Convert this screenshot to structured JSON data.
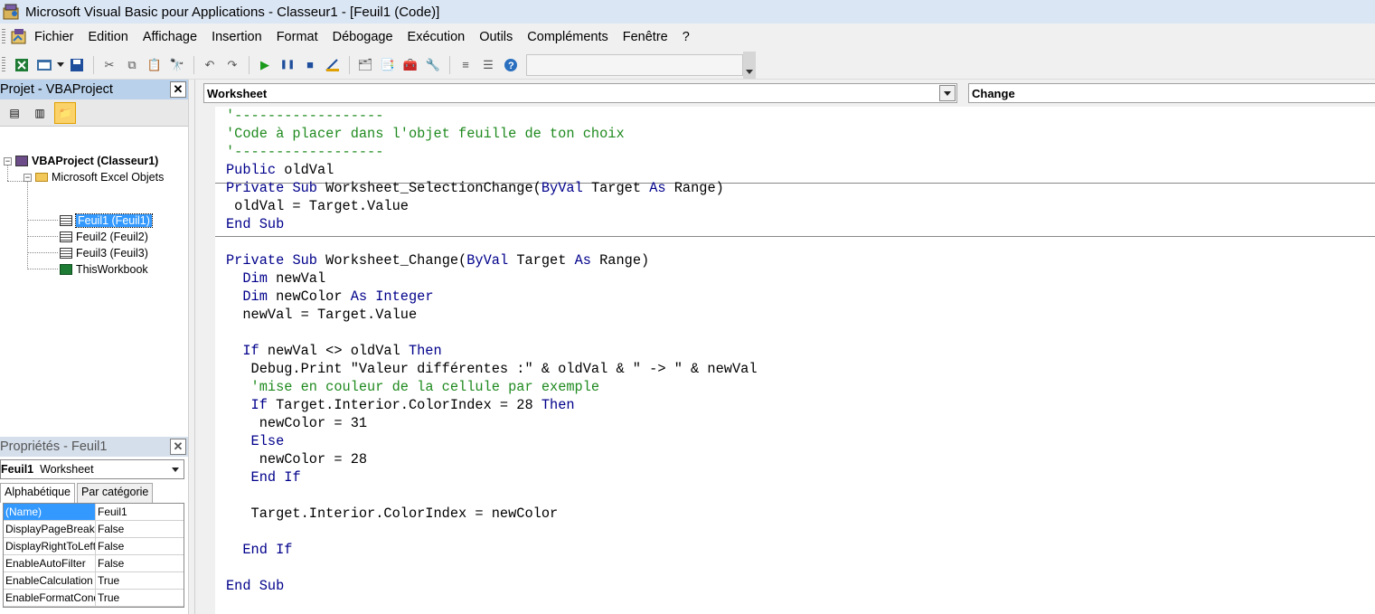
{
  "window": {
    "title": "Microsoft Visual Basic pour Applications - Classeur1 - [Feuil1 (Code)]"
  },
  "menu": [
    "Fichier",
    "Edition",
    "Affichage",
    "Insertion",
    "Format",
    "Débogage",
    "Exécution",
    "Outils",
    "Compléments",
    "Fenêtre",
    "?"
  ],
  "project": {
    "title": "Projet - VBAProject",
    "root": "VBAProject (Classeur1)",
    "folder": "Microsoft Excel Objets",
    "items": [
      "Feuil1 (Feuil1)",
      "Feuil2 (Feuil2)",
      "Feuil3 (Feuil3)",
      "ThisWorkbook"
    ],
    "selected_item": "Feuil1 (Feuil1)"
  },
  "properties": {
    "title": "Propriétés - Feuil1",
    "object_name": "Feuil1",
    "object_type": "Worksheet",
    "tabs": [
      "Alphabétique",
      "Par catégorie"
    ],
    "rows": [
      {
        "name": "(Name)",
        "value": "Feuil1"
      },
      {
        "name": "DisplayPageBreaks",
        "value": "False"
      },
      {
        "name": "DisplayRightToLeft",
        "value": "False"
      },
      {
        "name": "EnableAutoFilter",
        "value": "False"
      },
      {
        "name": "EnableCalculation",
        "value": "True"
      },
      {
        "name": "EnableFormatConditionsCalculation",
        "value": "True"
      }
    ]
  },
  "code": {
    "object_combo": "Worksheet",
    "procedure_combo": "Change",
    "lines": [
      "'------------------",
      "'Code à placer dans l'objet feuille de ton choix",
      "'------------------",
      "Public oldVal",
      "Private Sub Worksheet_SelectionChange(ByVal Target As Range)",
      " oldVal = Target.Value",
      "End Sub",
      "",
      "Private Sub Worksheet_Change(ByVal Target As Range)",
      "  Dim newVal",
      "  Dim newColor As Integer",
      "  newVal = Target.Value",
      "",
      "  If newVal <> oldVal Then",
      "   Debug.Print \"Valeur différentes :\" & oldVal & \" -> \" & newVal",
      "   'mise en couleur de la cellule par exemple",
      "   If Target.Interior.ColorIndex = 28 Then",
      "    newColor = 31",
      "   Else",
      "    newColor = 28",
      "   End If",
      "",
      "   Target.Interior.ColorIndex = newColor",
      "",
      "  End If",
      "",
      "End Sub"
    ]
  },
  "colors": {
    "keyword": "#00008b",
    "comment": "#1f8a1f",
    "selection": "#3399ff",
    "titlebar": "#dbe6f4"
  }
}
